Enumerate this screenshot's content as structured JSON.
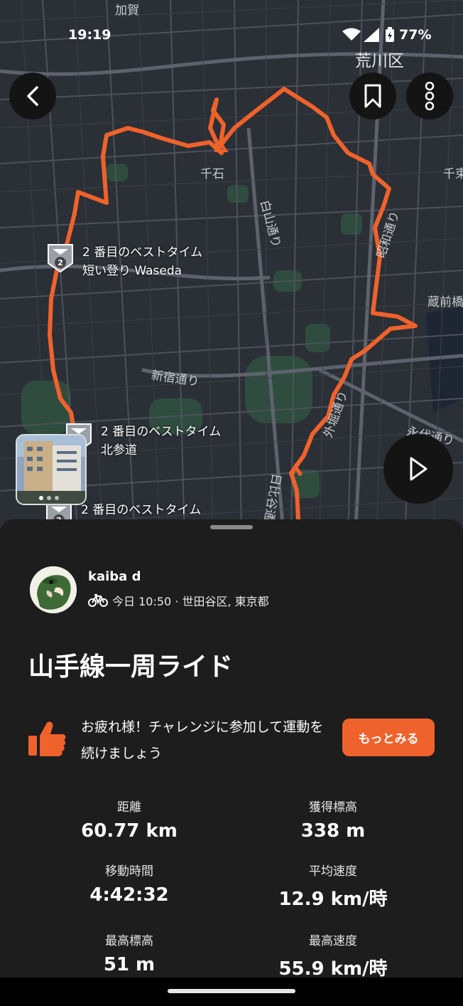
{
  "status_bar": {
    "time": "19:19",
    "battery": "77%"
  },
  "map": {
    "labels": {
      "kaga": "加賀",
      "arakawa": "荒川区",
      "sengoku": "千石",
      "hakusan": "白山通り",
      "showa": "昭和通り",
      "chiyoda_edge": "千束",
      "kuramae": "蔵前橋",
      "shinjuku": "新宿通り",
      "sotobori": "外堀通り",
      "eitai": "永代通り",
      "hibiya": "日比谷通り"
    },
    "segments": [
      {
        "rank": "2",
        "title": "2 番目のベストタイム",
        "name": "短い登り Waseda"
      },
      {
        "rank": "2",
        "title": "2 番目のベストタイム",
        "name": "北参道"
      },
      {
        "rank": "2",
        "title": "2 番目のベストタイム",
        "name": ""
      }
    ],
    "route_color": "#f0622b",
    "icons": {
      "back": "back-arrow-icon",
      "bookmark": "bookmark-icon",
      "more": "more-vertical-icon",
      "play": "play-icon"
    }
  },
  "activity": {
    "athlete_name": "kaiba d",
    "meta": "今日 10:50 · 世田谷区, 東京都",
    "title": "山手線一周ライド",
    "promo_text": "お疲れ様！チャレンジに参加して運動を続けましょう",
    "more_button": "もっとみる",
    "stats": [
      {
        "label": "距離",
        "value": "60.77 km"
      },
      {
        "label": "獲得標高",
        "value": "338 m"
      },
      {
        "label": "移動時間",
        "value": "4:42:32"
      },
      {
        "label": "平均速度",
        "value": "12.9 km/時"
      },
      {
        "label": "最高標高",
        "value": "51 m"
      },
      {
        "label": "最高速度",
        "value": "55.9 km/時"
      }
    ]
  },
  "colors": {
    "accent": "#f0622b",
    "sheet": "#1d1d1d",
    "map_bg": "#2b2f36"
  }
}
